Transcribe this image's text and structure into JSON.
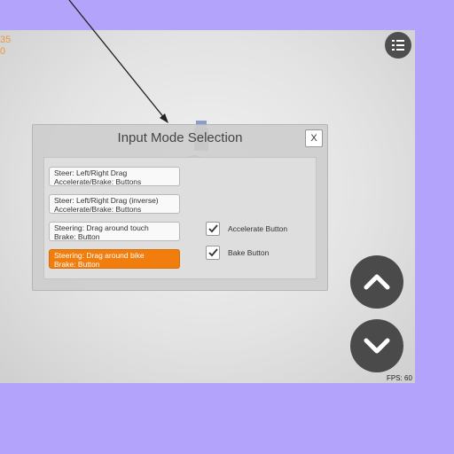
{
  "hud": {
    "top_left_numbers": "35\n0"
  },
  "dialog": {
    "title": "Input Mode Selection",
    "close_label": "X",
    "options": [
      {
        "line1": "Steer: Left/Right Drag",
        "line2": "Accelerate/Brake: Buttons",
        "selected": false
      },
      {
        "line1": "Steer: Left/Right Drag (inverse)",
        "line2": "Accelerate/Brake: Buttons",
        "selected": false
      },
      {
        "line1": "Steering: Drag around touch",
        "line2": "Brake: Button",
        "selected": false
      },
      {
        "line1": "Steering: Drag around bike",
        "line2": "Brake: Button",
        "selected": true
      }
    ],
    "checkboxes": [
      {
        "label": "Accelerate Button",
        "checked": true
      },
      {
        "label": "Bake Button",
        "checked": true
      }
    ]
  },
  "controls": {
    "menu_icon": "list-icon",
    "up_icon": "chevron-up-icon",
    "down_icon": "chevron-down-icon"
  },
  "status": {
    "fps": "FPS: 60"
  },
  "colors": {
    "background": "#b3a3fb",
    "selected_option": "#f07d0c",
    "round_button": "#4a4a4a"
  }
}
